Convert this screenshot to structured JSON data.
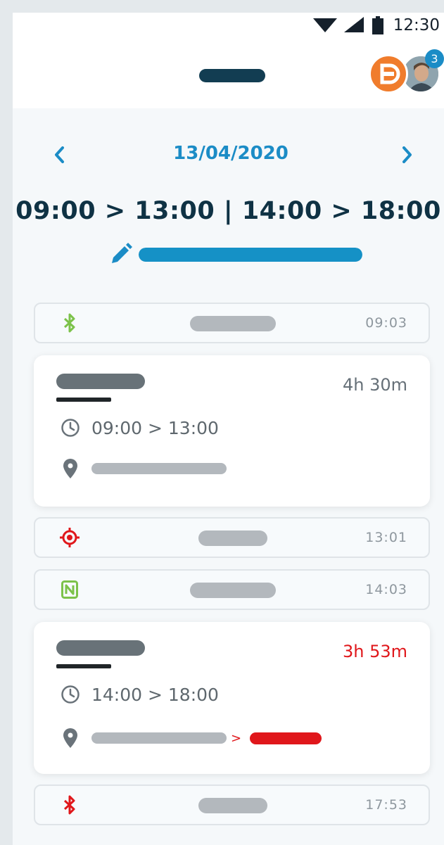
{
  "status_bar": {
    "time": "12:30",
    "icons": [
      "wifi-icon",
      "signal-icon",
      "battery-icon"
    ]
  },
  "header": {
    "logo_placeholder": "app-logo-bar",
    "avatars": {
      "brand_letter": "D",
      "badge_count": "3"
    }
  },
  "date_nav": {
    "prev_icon": "chevron-left-icon",
    "date": "13/04/2020",
    "next_icon": "chevron-right-icon"
  },
  "schedule": {
    "hours": "09:00 > 13:00 | 14:00 > 18:00",
    "edit_icon": "pencil-icon",
    "progress_fraction": 1.0
  },
  "timeline": [
    {
      "kind": "event",
      "icon": "bluetooth-icon",
      "icon_color": "#7cc24a",
      "time": "09:03"
    },
    {
      "kind": "shift",
      "duration": "4h 30m",
      "duration_late": false,
      "time_range": "09:00 > 13:00",
      "location_anomaly": false
    },
    {
      "kind": "event",
      "icon": "gps-target-icon",
      "icon_color": "#e0171b",
      "time": "13:01"
    },
    {
      "kind": "event",
      "icon": "nfc-icon",
      "icon_color": "#7cc24a",
      "time": "14:03"
    },
    {
      "kind": "shift",
      "duration": "3h 53m",
      "duration_late": true,
      "time_range": "14:00 > 18:00",
      "location_anomaly": true,
      "location_arrow": ">"
    },
    {
      "kind": "event",
      "icon": "bluetooth-icon",
      "icon_color": "#e0171b",
      "time": "17:53"
    }
  ],
  "colors": {
    "accent": "#1b8cc6",
    "heading": "#0f3244",
    "alert": "#e0171b",
    "ok_green": "#7cc24a",
    "brand_orange": "#f07c2c"
  }
}
